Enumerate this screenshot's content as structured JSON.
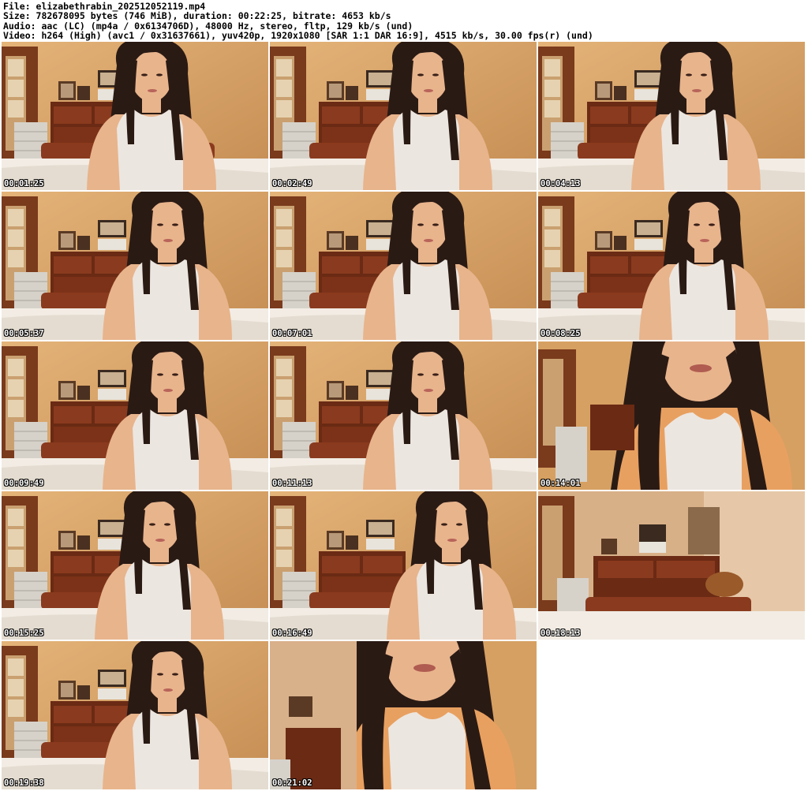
{
  "header": {
    "file": "File: elizabethrabin_202512052119.mp4",
    "size": "Size: 782678095 bytes (746 MiB), duration: 00:22:25, bitrate: 4653 kb/s",
    "audio": "Audio: aac (LC) (mp4a / 0x6134706D), 48000 Hz, stereo, fltp, 129 kb/s (und)",
    "video": "Video: h264 (High) (avc1 / 0x31637661), yuv420p, 1920x1080 [SAR 1:1 DAR 16:9], 4515 kb/s, 30.00 fps(r) (und)"
  },
  "thumbnails": [
    {
      "time": "00:01:25",
      "scene": "person"
    },
    {
      "time": "00:02:49",
      "scene": "person"
    },
    {
      "time": "00:04:13",
      "scene": "person"
    },
    {
      "time": "00:05:37",
      "scene": "person"
    },
    {
      "time": "00:07:01",
      "scene": "person"
    },
    {
      "time": "00:08:25",
      "scene": "person"
    },
    {
      "time": "00:09:49",
      "scene": "person"
    },
    {
      "time": "00:11:13",
      "scene": "person"
    },
    {
      "time": "00:14:01",
      "scene": "closeup"
    },
    {
      "time": "00:15:25",
      "scene": "person"
    },
    {
      "time": "00:16:49",
      "scene": "leaning"
    },
    {
      "time": "00:18:13",
      "scene": "empty"
    },
    {
      "time": "00:19:38",
      "scene": "person"
    },
    {
      "time": "00:21:02",
      "scene": "closeup"
    }
  ],
  "colors": {
    "wall": "#d9a86a",
    "door": "#7a3a1c",
    "dresser": "#6a2a14",
    "bed": "#f2ece4",
    "hair": "#2a1a14",
    "skin": "#e8b48c",
    "top": "#ece6e0",
    "cabinet": "#d6d2ca"
  }
}
